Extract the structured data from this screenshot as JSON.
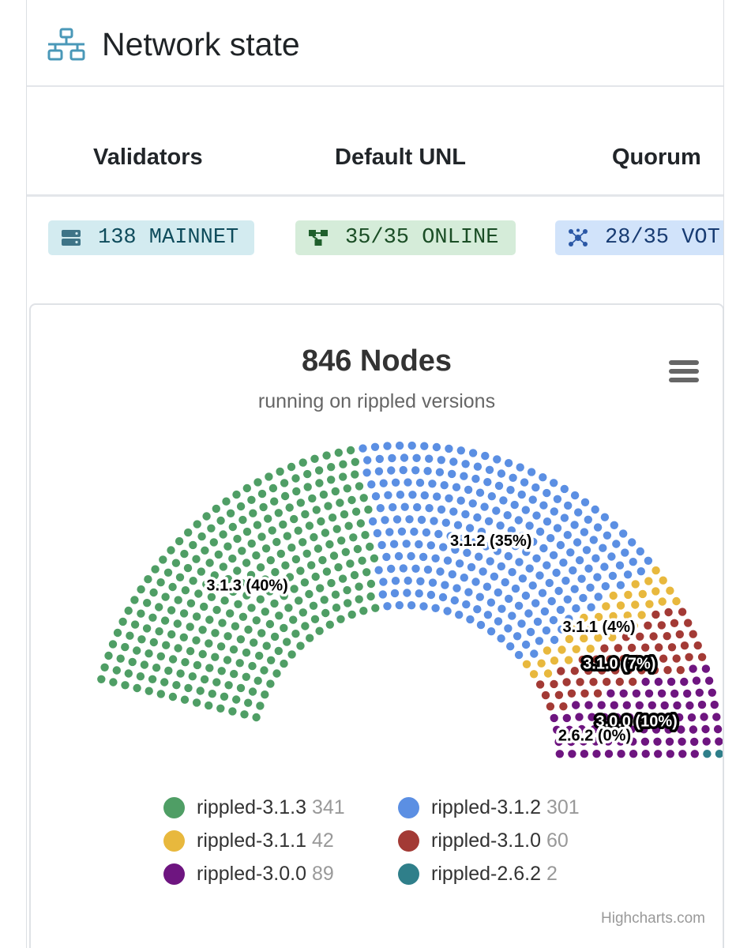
{
  "header": {
    "title": "Network state",
    "icon": "network-icon"
  },
  "stats": {
    "columns": [
      {
        "label": "Validators"
      },
      {
        "label": "Default UNL"
      },
      {
        "label": "Quorum"
      }
    ],
    "badges": [
      {
        "text": "138 MAINNET",
        "icon": "server-icon",
        "color": "#d3ebf0"
      },
      {
        "text": "35/35 ONLINE",
        "icon": "unl-nodes-icon",
        "color": "#d5ecd9"
      },
      {
        "text": "28/35 VOT",
        "icon": "quorum-icon",
        "color": "#d1e3fa"
      }
    ]
  },
  "chart": {
    "menu_icon": "hamburger-menu-icon",
    "credits": "Highcharts.com"
  },
  "chart_data": {
    "type": "item",
    "title": "846 Nodes",
    "subtitle": "running on rippled versions",
    "series": [
      {
        "name": "rippled-3.1.3",
        "value": 341,
        "label": "3.1.3 (40%)",
        "color": "#4f9e65"
      },
      {
        "name": "rippled-3.1.2",
        "value": 301,
        "label": "3.1.2 (35%)",
        "color": "#5b8fe3"
      },
      {
        "name": "rippled-3.1.1",
        "value": 42,
        "label": "3.1.1 (4%)",
        "color": "#e8b83d"
      },
      {
        "name": "rippled-3.1.0",
        "value": 60,
        "label": "3.1.0 (7%)",
        "color": "#a33a35"
      },
      {
        "name": "rippled-3.0.0",
        "value": 89,
        "label": "3.0.0 (10%)",
        "color": "#6e1580"
      },
      {
        "name": "rippled-2.6.2",
        "value": 2,
        "label": "2.6.2 (0%)",
        "color": "#2f7f8a"
      }
    ],
    "legend": "bottom, two columns"
  }
}
